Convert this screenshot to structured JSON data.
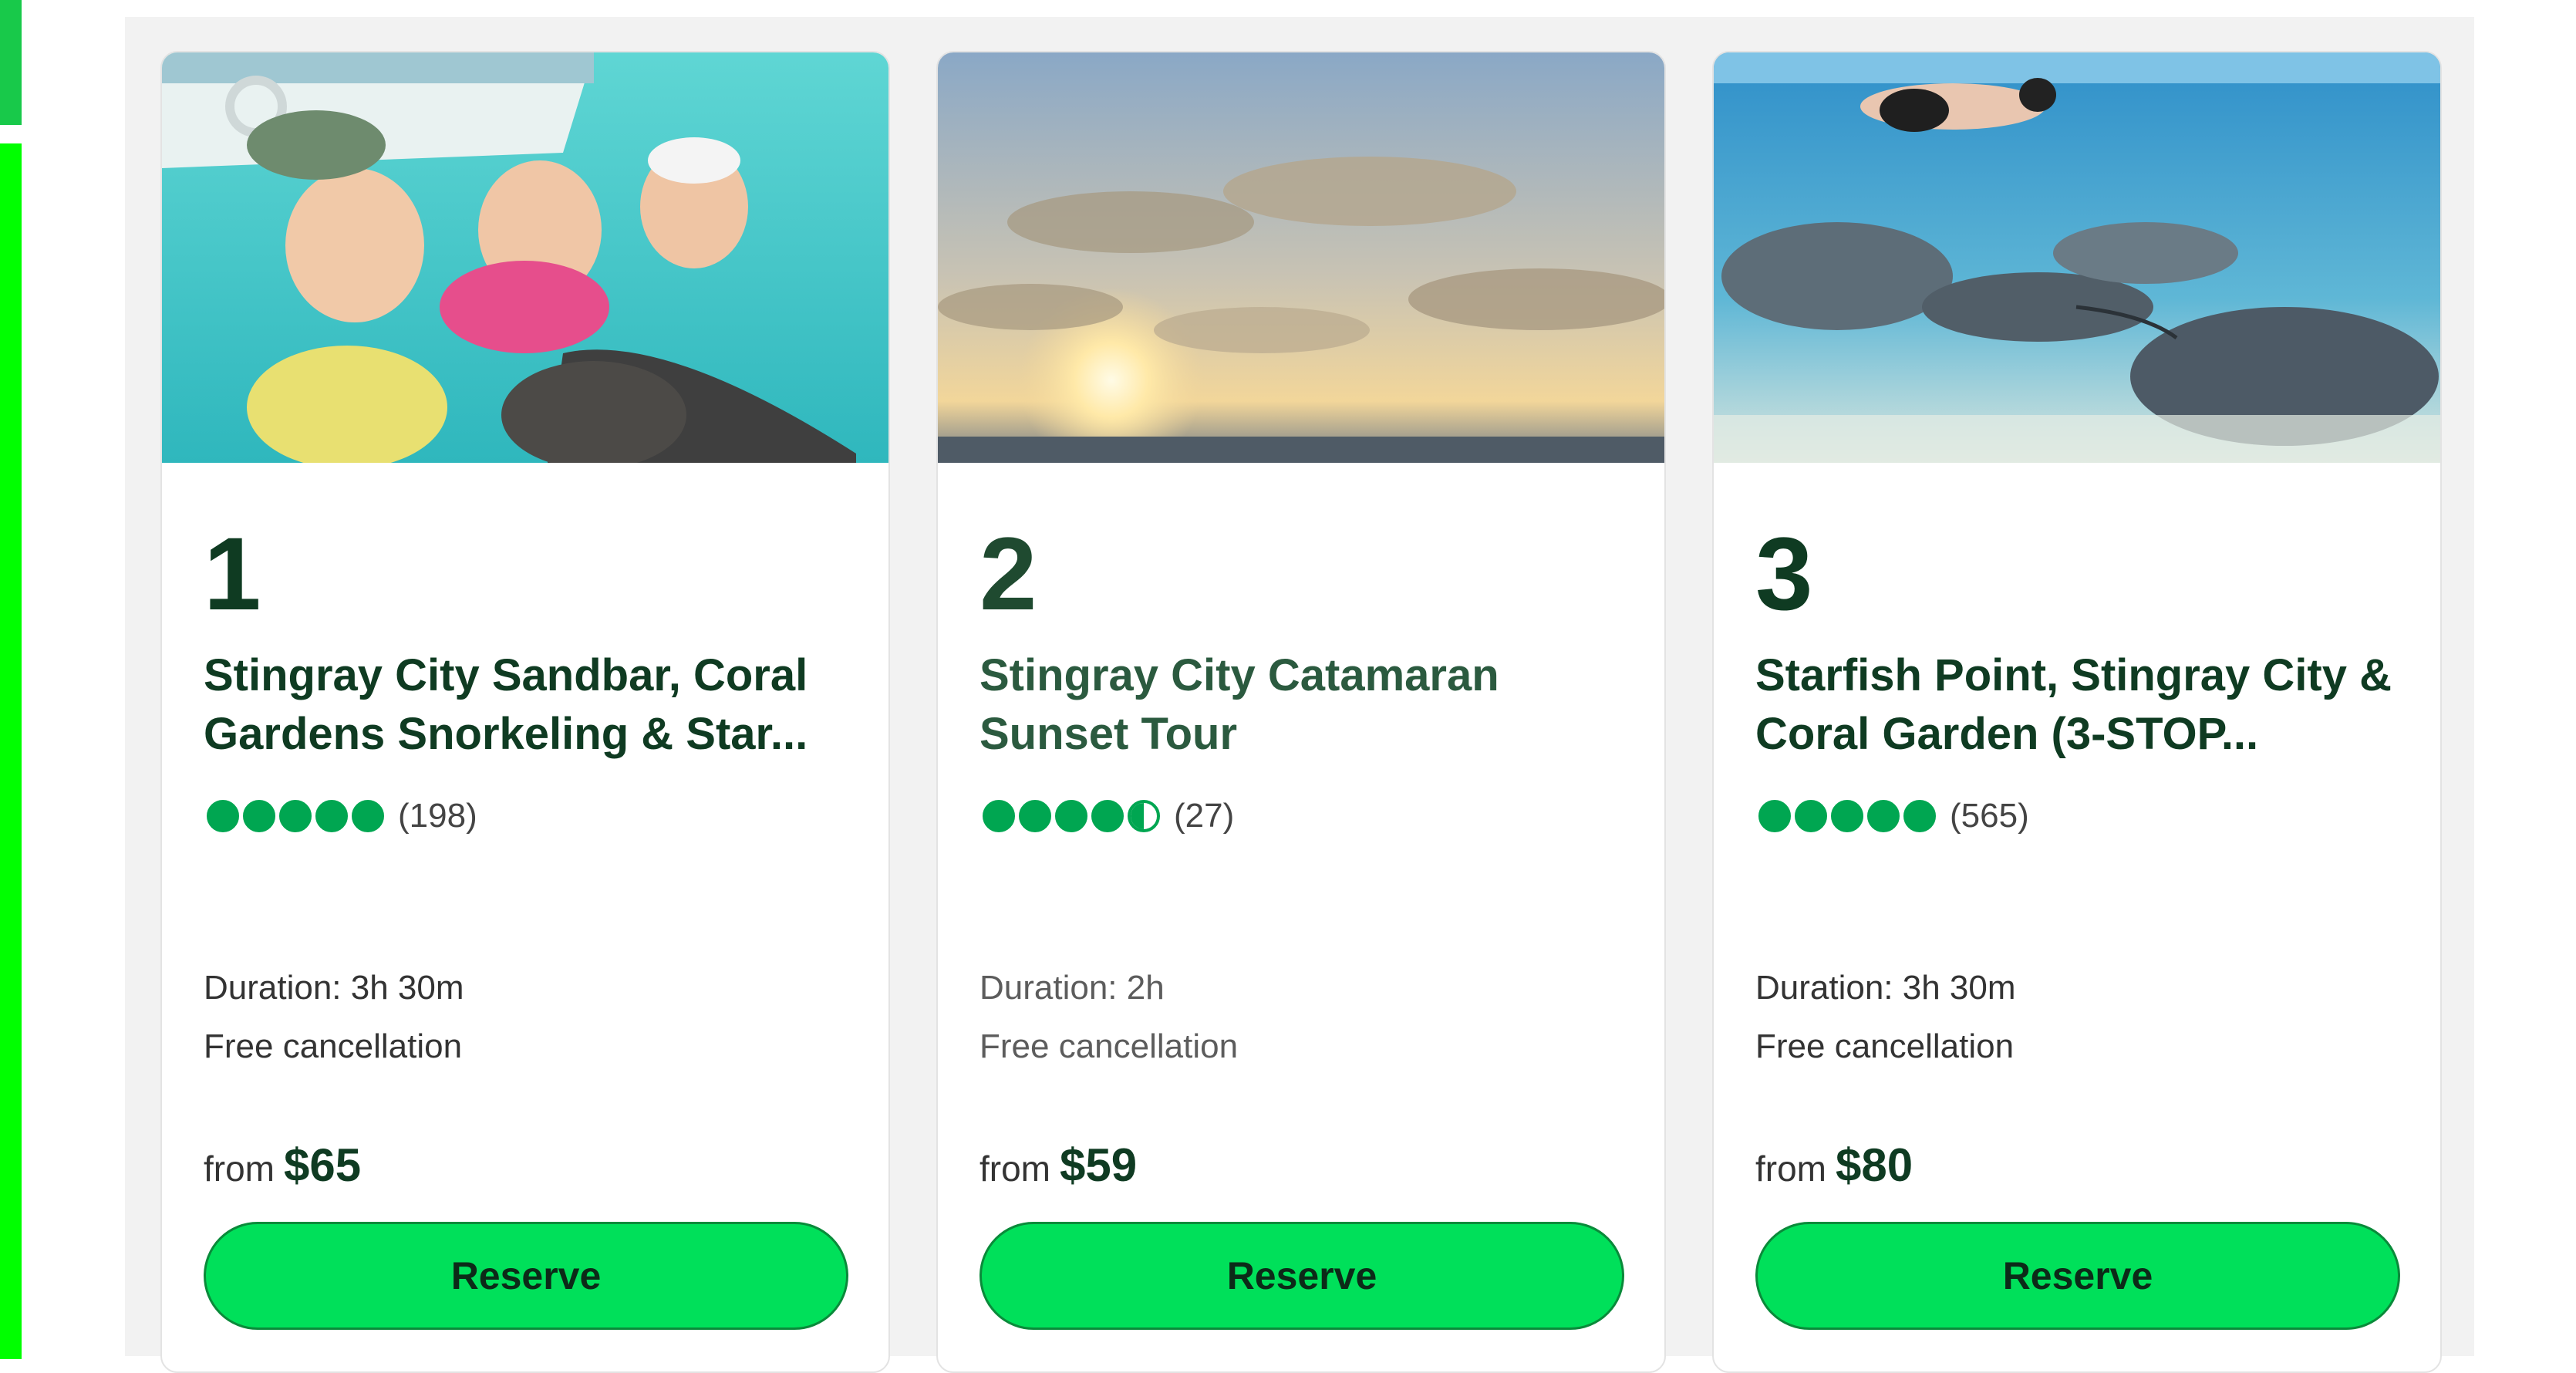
{
  "colors": {
    "accent_green": "#00e05a",
    "rating_green": "#00a651",
    "dark_green_text": "#0f3b22",
    "side_bar_top": "#18c94a",
    "side_bar_bottom": "#00ff00"
  },
  "cards": [
    {
      "rank": "1",
      "title": "Stingray City Sandbar, Coral Gardens Snorkeling & Star...",
      "rating": 5,
      "review_count": "(198)",
      "duration": "Duration: 3h 30m",
      "cancellation": "Free cancellation",
      "price_prefix": "from",
      "price": "$65",
      "button_label": "Reserve"
    },
    {
      "rank": "2",
      "title": "Stingray City Catamaran Sunset Tour",
      "rating": 4.5,
      "review_count": "(27)",
      "duration": "Duration: 2h",
      "cancellation": "Free cancellation",
      "price_prefix": "from",
      "price": "$59",
      "button_label": "Reserve"
    },
    {
      "rank": "3",
      "title": "Starfish Point, Stingray City & Coral Garden (3-STOP...",
      "rating": 5,
      "review_count": "(565)",
      "duration": "Duration: 3h 30m",
      "cancellation": "Free cancellation",
      "price_prefix": "from",
      "price": "$80",
      "button_label": "Reserve"
    }
  ]
}
